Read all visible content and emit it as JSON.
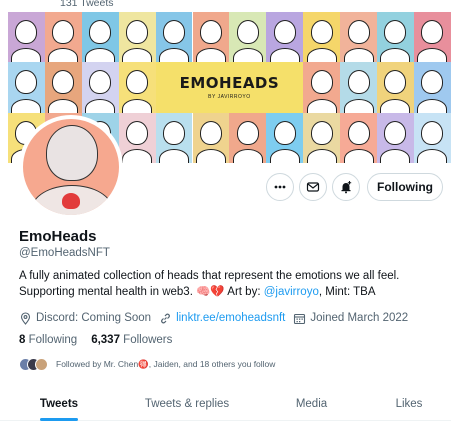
{
  "header": {
    "tweet_count": "131 Tweets"
  },
  "banner": {
    "logo_text": "EMOHEADS",
    "subtitle": "BY JAVIRROYO",
    "tile_colors": [
      [
        "#c9a7d6",
        "#f2a98f",
        "#7fc7e6",
        "#efe6a0",
        "#86c6e8",
        "#f0a88c",
        "#d8e8b5",
        "#b9a6e0",
        "#f5d66a",
        "#f1b39a",
        "#93d1df",
        "#e88f9c"
      ],
      [
        "#a9d6f0",
        "#e7a67d",
        "#d3d3f0",
        "#f6e07a",
        "#f6e07a",
        "#f6e07a",
        "#f6e07a",
        "#a6d7a4",
        "#f2a98f",
        "#b4dbe8",
        "#f0d37c",
        "#9fc9ef"
      ],
      [
        "#f6e07a",
        "#f2a98f",
        "#9ed3e8",
        "#efd0d6",
        "#b9dfee",
        "#efd38e",
        "#f0a88c",
        "#7ecdf0",
        "#ead9a1",
        "#f6aa96",
        "#c8b9e8",
        "#c7e3f5"
      ]
    ]
  },
  "profile": {
    "name": "EmoHeads",
    "handle": "@EmoHeadsNFT",
    "bio_line1": "A fully animated collection of heads that represent the emotions we all feel.",
    "bio_line2_prefix": "Supporting mental health in web3. 🧠💔 Art by: ",
    "bio_link": "@javirroyo",
    "bio_line2_suffix": ", Mint: TBA",
    "location": "Discord: Coming Soon",
    "website": "linktr.ee/emoheadsnft",
    "joined": "Joined March 2022",
    "following_count": "8",
    "following_label": "Following",
    "followers_count": "6,337",
    "followers_label": "Followers",
    "followed_by": "Followed by Mr. Chen🉐, Jaiden, and 18 others you follow"
  },
  "actions": {
    "more_icon": "ellipsis-icon",
    "message_icon": "envelope-icon",
    "notify_icon": "bell-plus-icon",
    "follow_label": "Following"
  },
  "tabs": [
    {
      "label": "Tweets",
      "active": true
    },
    {
      "label": "Tweets & replies",
      "active": false
    },
    {
      "label": "Media",
      "active": false
    },
    {
      "label": "Likes",
      "active": false
    }
  ],
  "colors": {
    "accent": "#1d9bf0",
    "text": "#0f1419",
    "muted": "#536471",
    "border": "#cfd9de"
  }
}
